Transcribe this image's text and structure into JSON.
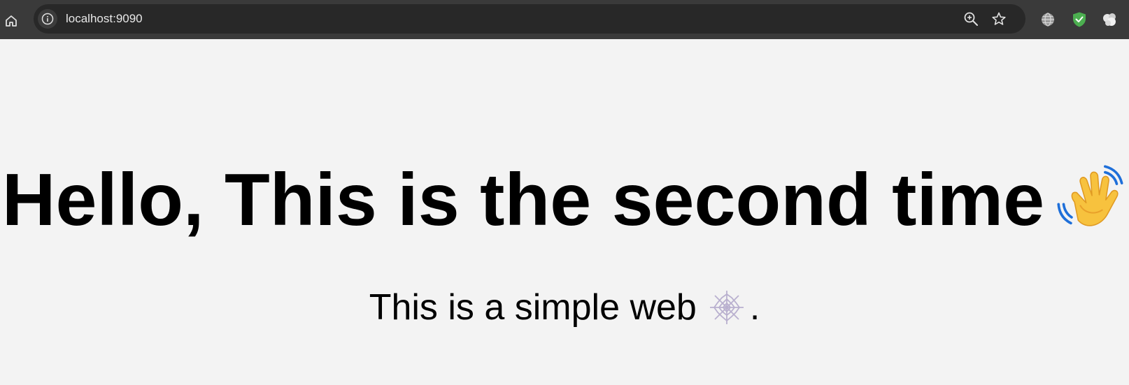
{
  "browser": {
    "address_bar": {
      "url": "localhost:9090"
    },
    "icons": {
      "home": "home-icon",
      "site_info": "info-icon",
      "zoom": "zoom-in-icon",
      "bookmark": "star-icon",
      "extensions": [
        "globe-icon",
        "shield-check-icon",
        "puzzle-icon"
      ]
    },
    "colors": {
      "toolbar": "#3a3a3a",
      "omnibox": "#282828",
      "shield": "#4caf50"
    }
  },
  "page": {
    "heading": "Hello, This is the second time",
    "heading_emoji": "waving-hand-icon",
    "subtitle_text": "This is a simple web",
    "subtitle_emoji": "spider-web-icon",
    "subtitle_end": ".",
    "background": "#f3f3f3"
  }
}
